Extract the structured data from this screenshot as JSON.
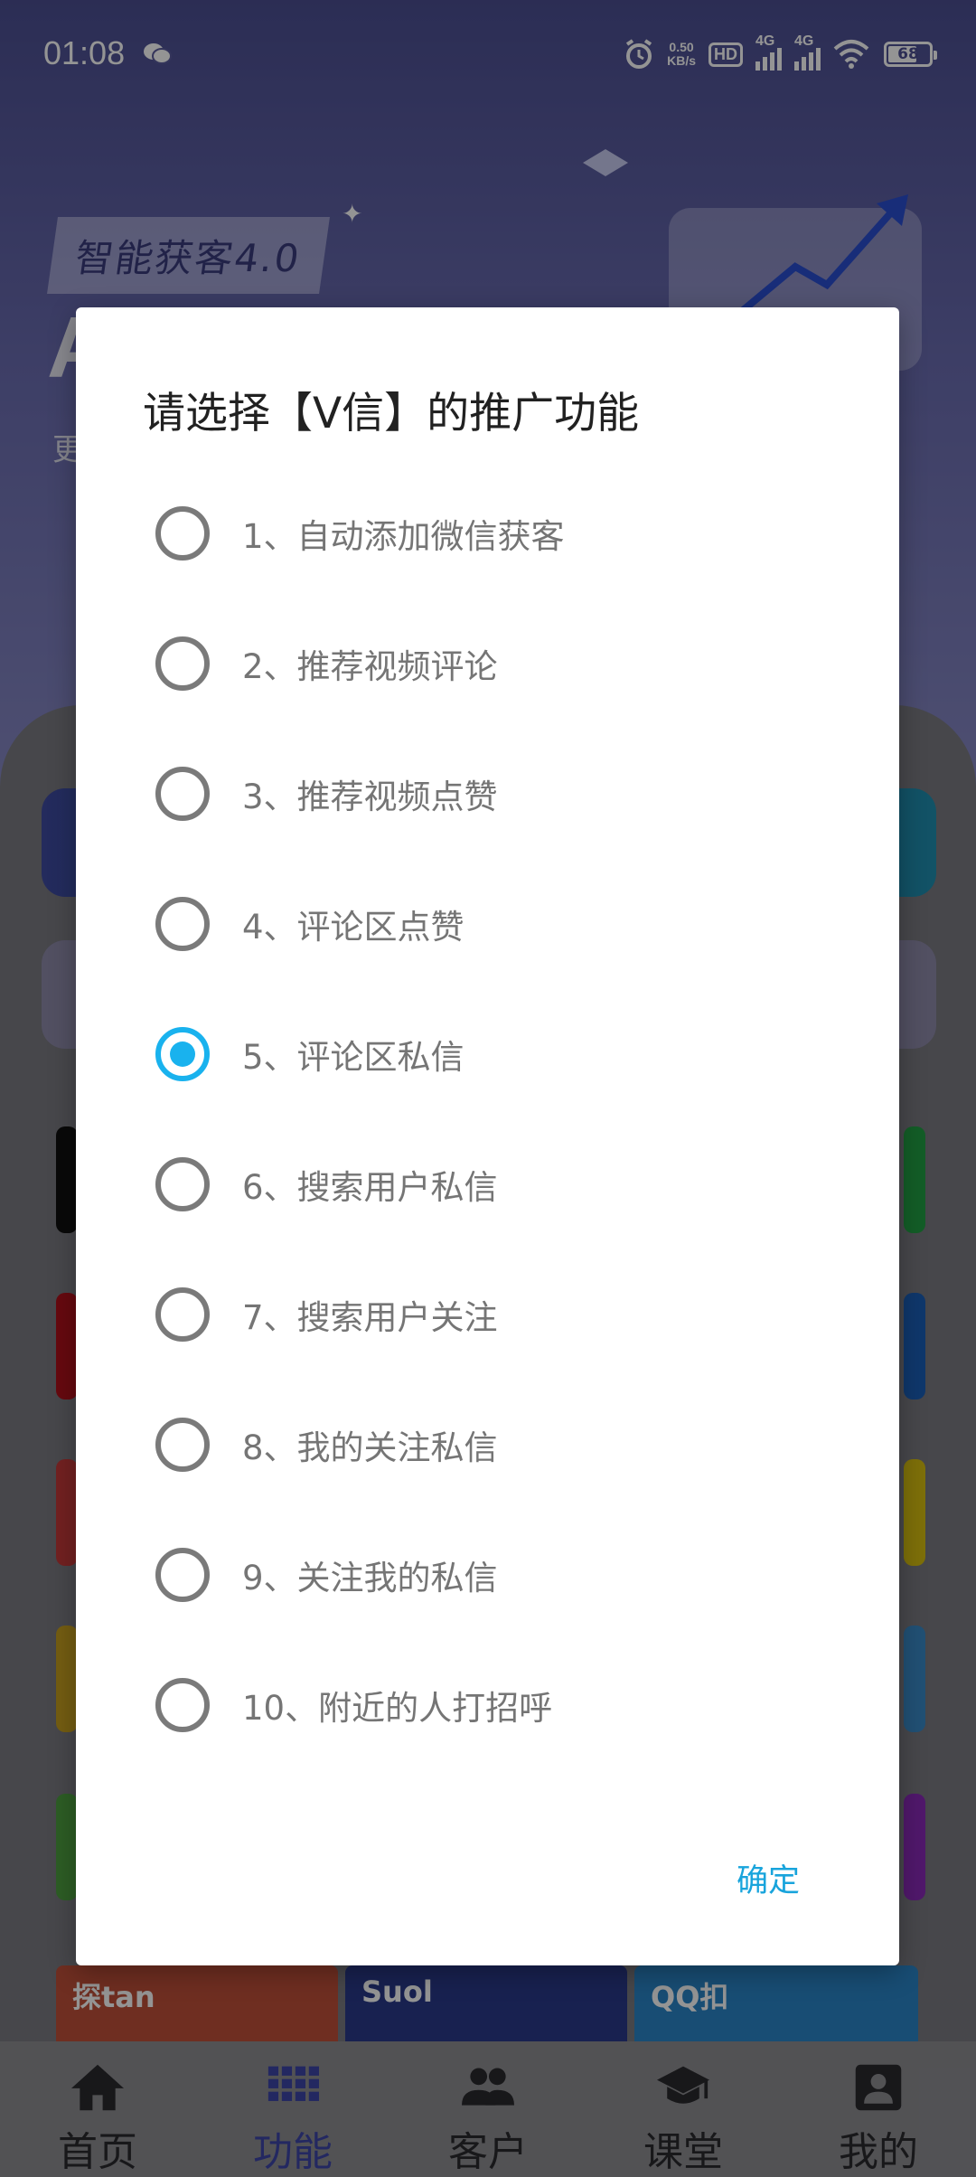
{
  "status_bar": {
    "time": "01:08",
    "net_speed_value": "0.50",
    "net_speed_unit": "KB/s",
    "hd_label": "HD",
    "sim1_label": "4G",
    "sim2_label": "4G",
    "battery": "68"
  },
  "hero": {
    "tag": "智能获客4.0",
    "big_text": "A",
    "sub_text": "更"
  },
  "promo_tiles": [
    {
      "label": "探tan"
    },
    {
      "label": "Suol"
    },
    {
      "label": "QQ扣"
    }
  ],
  "dialog": {
    "title": "请选择【V信】的推广功能",
    "selected_index": 4,
    "options": [
      {
        "label": "1、自动添加微信获客"
      },
      {
        "label": "2、推荐视频评论"
      },
      {
        "label": "3、推荐视频点赞"
      },
      {
        "label": "4、评论区点赞"
      },
      {
        "label": "5、评论区私信"
      },
      {
        "label": "6、搜索用户私信"
      },
      {
        "label": "7、搜索用户关注"
      },
      {
        "label": "8、我的关注私信"
      },
      {
        "label": "9、关注我的私信"
      },
      {
        "label": "10、附近的人打招呼"
      }
    ],
    "confirm_label": "确定"
  },
  "bottom_nav": {
    "active_index": 1,
    "items": [
      {
        "label": "首页",
        "icon": "home-icon"
      },
      {
        "label": "功能",
        "icon": "grid-icon"
      },
      {
        "label": "客户",
        "icon": "people-icon"
      },
      {
        "label": "课堂",
        "icon": "graduation-cap-icon"
      },
      {
        "label": "我的",
        "icon": "person-icon"
      }
    ]
  },
  "colors": {
    "accent": "#19b2ee",
    "nav_active": "#3d46a8",
    "radio_off": "#7a7a7a"
  }
}
